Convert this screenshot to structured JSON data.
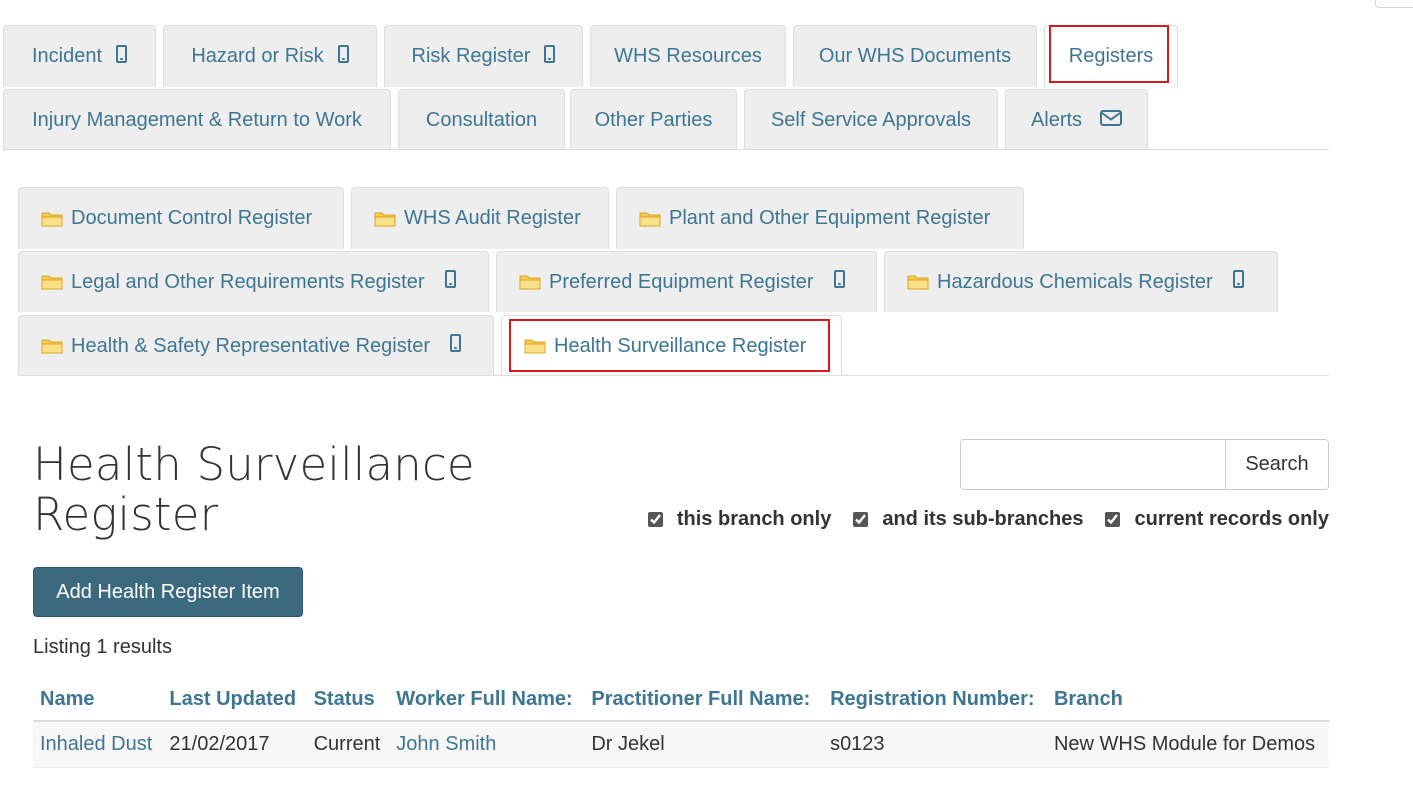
{
  "main_tabs": [
    {
      "label": "Incident",
      "icon": "phone-icon"
    },
    {
      "label": "Hazard or Risk",
      "icon": "phone-icon"
    },
    {
      "label": "Risk Register",
      "icon": "phone-icon"
    },
    {
      "label": "WHS Resources"
    },
    {
      "label": "Our WHS Documents"
    },
    {
      "label": "Registers",
      "active": true
    },
    {
      "label": "Injury Management & Return to Work"
    },
    {
      "label": "Consultation"
    },
    {
      "label": "Other Parties"
    },
    {
      "label": "Self Service Approvals"
    },
    {
      "label": "Alerts",
      "icon": "mail-icon"
    }
  ],
  "register_tabs": [
    {
      "label": "Document Control Register"
    },
    {
      "label": "WHS Audit Register"
    },
    {
      "label": "Plant and Other Equipment Register"
    },
    {
      "label": "Legal and Other Requirements Register",
      "icon": "phone-icon"
    },
    {
      "label": "Preferred Equipment Register",
      "icon": "phone-icon"
    },
    {
      "label": "Hazardous Chemicals Register",
      "icon": "phone-icon"
    },
    {
      "label": "Health & Safety Representative Register",
      "icon": "phone-icon"
    },
    {
      "label": "Health Surveillance Register",
      "active": true
    }
  ],
  "page": {
    "title_line1": "Health Surveillance",
    "title_line2": "Register"
  },
  "search": {
    "value": "",
    "button_label": "Search"
  },
  "filters": [
    {
      "label": "this branch only",
      "checked": true
    },
    {
      "label": "and its sub-branches",
      "checked": true
    },
    {
      "label": "current records only",
      "checked": true
    }
  ],
  "add_button_label": "Add Health Register Item",
  "listing_text": "Listing 1 results",
  "table": {
    "columns": [
      "Name",
      "Last Updated",
      "Status",
      "Worker Full Name:",
      "Practitioner Full Name:",
      "Registration Number:",
      "Branch"
    ],
    "rows": [
      [
        "Inhaled Dust",
        "21/02/2017",
        "Current",
        "John Smith",
        "Dr Jekel",
        "s0123",
        "New WHS Module for Demos"
      ]
    ]
  },
  "colors": {
    "link": "#3e7692",
    "tab_bg": "#eeeeee",
    "highlight": "#d7191f",
    "primary_button": "#3b6a7f"
  }
}
